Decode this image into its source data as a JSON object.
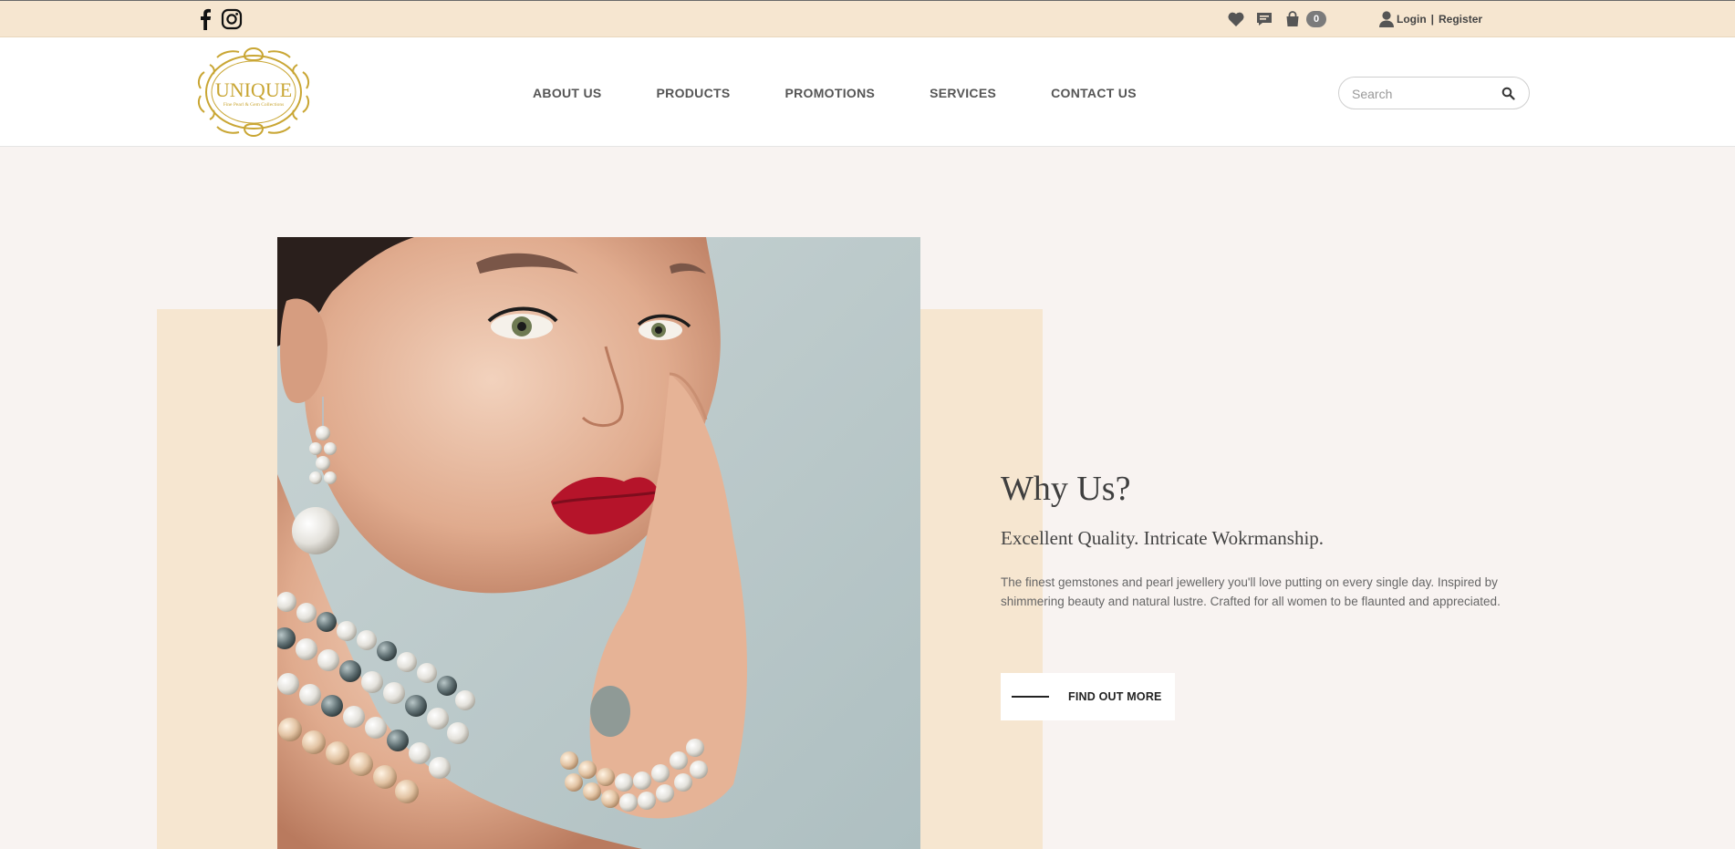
{
  "topbar": {
    "icons": [
      "facebook-icon",
      "instagram-icon",
      "heart-icon",
      "chat-icon",
      "shopping-bag-icon",
      "user-icon"
    ],
    "cart_count": "0",
    "login_label": "Login",
    "separator": "|",
    "register_label": "Register"
  },
  "header": {
    "logo_text": "UNIQUE",
    "logo_tagline": "Fine Pearl & Gem Collections",
    "nav": [
      {
        "label": "ABOUT US"
      },
      {
        "label": "PRODUCTS"
      },
      {
        "label": "PROMOTIONS"
      },
      {
        "label": "SERVICES"
      },
      {
        "label": "CONTACT US"
      }
    ],
    "search": {
      "placeholder": "Search",
      "value": ""
    }
  },
  "hero": {
    "image": "model-with-pearl-jewellery-photo",
    "title": "Why Us?",
    "subtitle": "Excellent Quality. Intricate Wokrmanship.",
    "body": "The finest gemstones and pearl jewellery you'll love putting on every single day. Inspired by shimmering beauty and natural lustre. Crafted for all women to be flaunted and appreciated.",
    "cta_label": "FIND OUT MORE"
  },
  "colors": {
    "topbar_bg": "#f6e6d0",
    "page_bg": "#f8f3f1",
    "accent_panel": "#f6e6d0",
    "logo_gold": "#c9a634",
    "lips_red": "#b5142a"
  }
}
